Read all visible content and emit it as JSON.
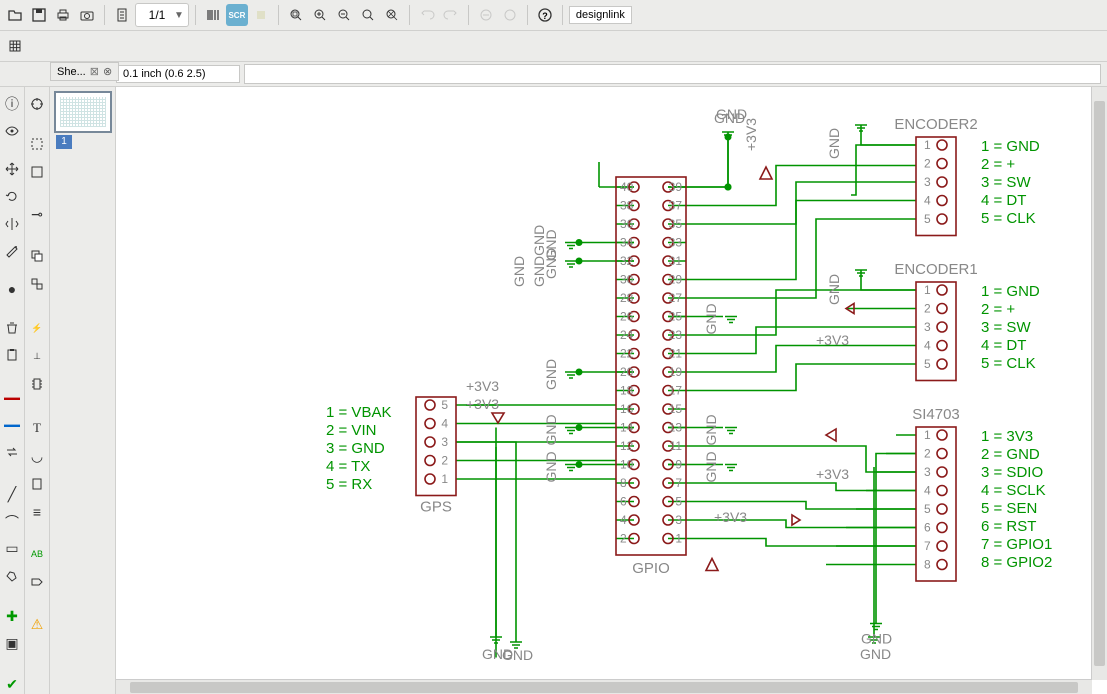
{
  "toolbar": {
    "page": "1/1",
    "designlink": "designlink",
    "buttons": [
      "open",
      "save",
      "print",
      "camera",
      "sheet",
      "barcode",
      "scr",
      "marker",
      "zoom-fit",
      "zoom-in",
      "zoom-out",
      "zoom-sel",
      "zoom-ext",
      "undo",
      "redo",
      "stop",
      "plus",
      "help"
    ]
  },
  "sidebar_tab": {
    "label": "She...",
    "close": "⊗",
    "page": "1"
  },
  "status": {
    "coord": "0.1 inch (0.6 2.5)",
    "cmd": ""
  },
  "schematic": {
    "gpio": {
      "name": "GPIO",
      "pins_left": [
        "40",
        "38",
        "36",
        "34",
        "32",
        "30",
        "28",
        "26",
        "24",
        "22",
        "20",
        "18",
        "16",
        "14",
        "12",
        "10",
        "8",
        "6",
        "4",
        "2"
      ],
      "pins_right": [
        "39",
        "37",
        "35",
        "33",
        "31",
        "29",
        "27",
        "25",
        "23",
        "21",
        "19",
        "17",
        "15",
        "13",
        "11",
        "9",
        "7",
        "5",
        "3",
        "1"
      ]
    },
    "gps": {
      "name": "GPS",
      "pins": [
        "5",
        "4",
        "3",
        "2",
        "1"
      ],
      "assign": [
        "1 = VBAK",
        "2 = VIN",
        "3 = GND",
        "4 = TX",
        "5 = RX"
      ]
    },
    "encoder2": {
      "name": "ENCODER2",
      "pins": [
        "1",
        "2",
        "3",
        "4",
        "5"
      ],
      "assign": [
        "1 = GND",
        "2 = +",
        "3 = SW",
        "4 = DT",
        "5 = CLK"
      ]
    },
    "encoder1": {
      "name": "ENCODER1",
      "pins": [
        "1",
        "2",
        "3",
        "4",
        "5"
      ],
      "assign": [
        "1 = GND",
        "2 = +",
        "3 = SW",
        "4 = DT",
        "5 = CLK"
      ]
    },
    "si4703": {
      "name": "SI4703",
      "pins": [
        "1",
        "2",
        "3",
        "4",
        "5",
        "6",
        "7",
        "8"
      ],
      "assign": [
        "1 = 3V3",
        "2 = GND",
        "3 = SDIO",
        "4 = SCLK",
        "5 = SEN",
        "6 = RST",
        "7 = GPIO1",
        "8 = GPIO2"
      ]
    },
    "labels": {
      "gnd": "GND",
      "v33": "+3V3",
      "gndgnd": "GNDGND"
    }
  }
}
